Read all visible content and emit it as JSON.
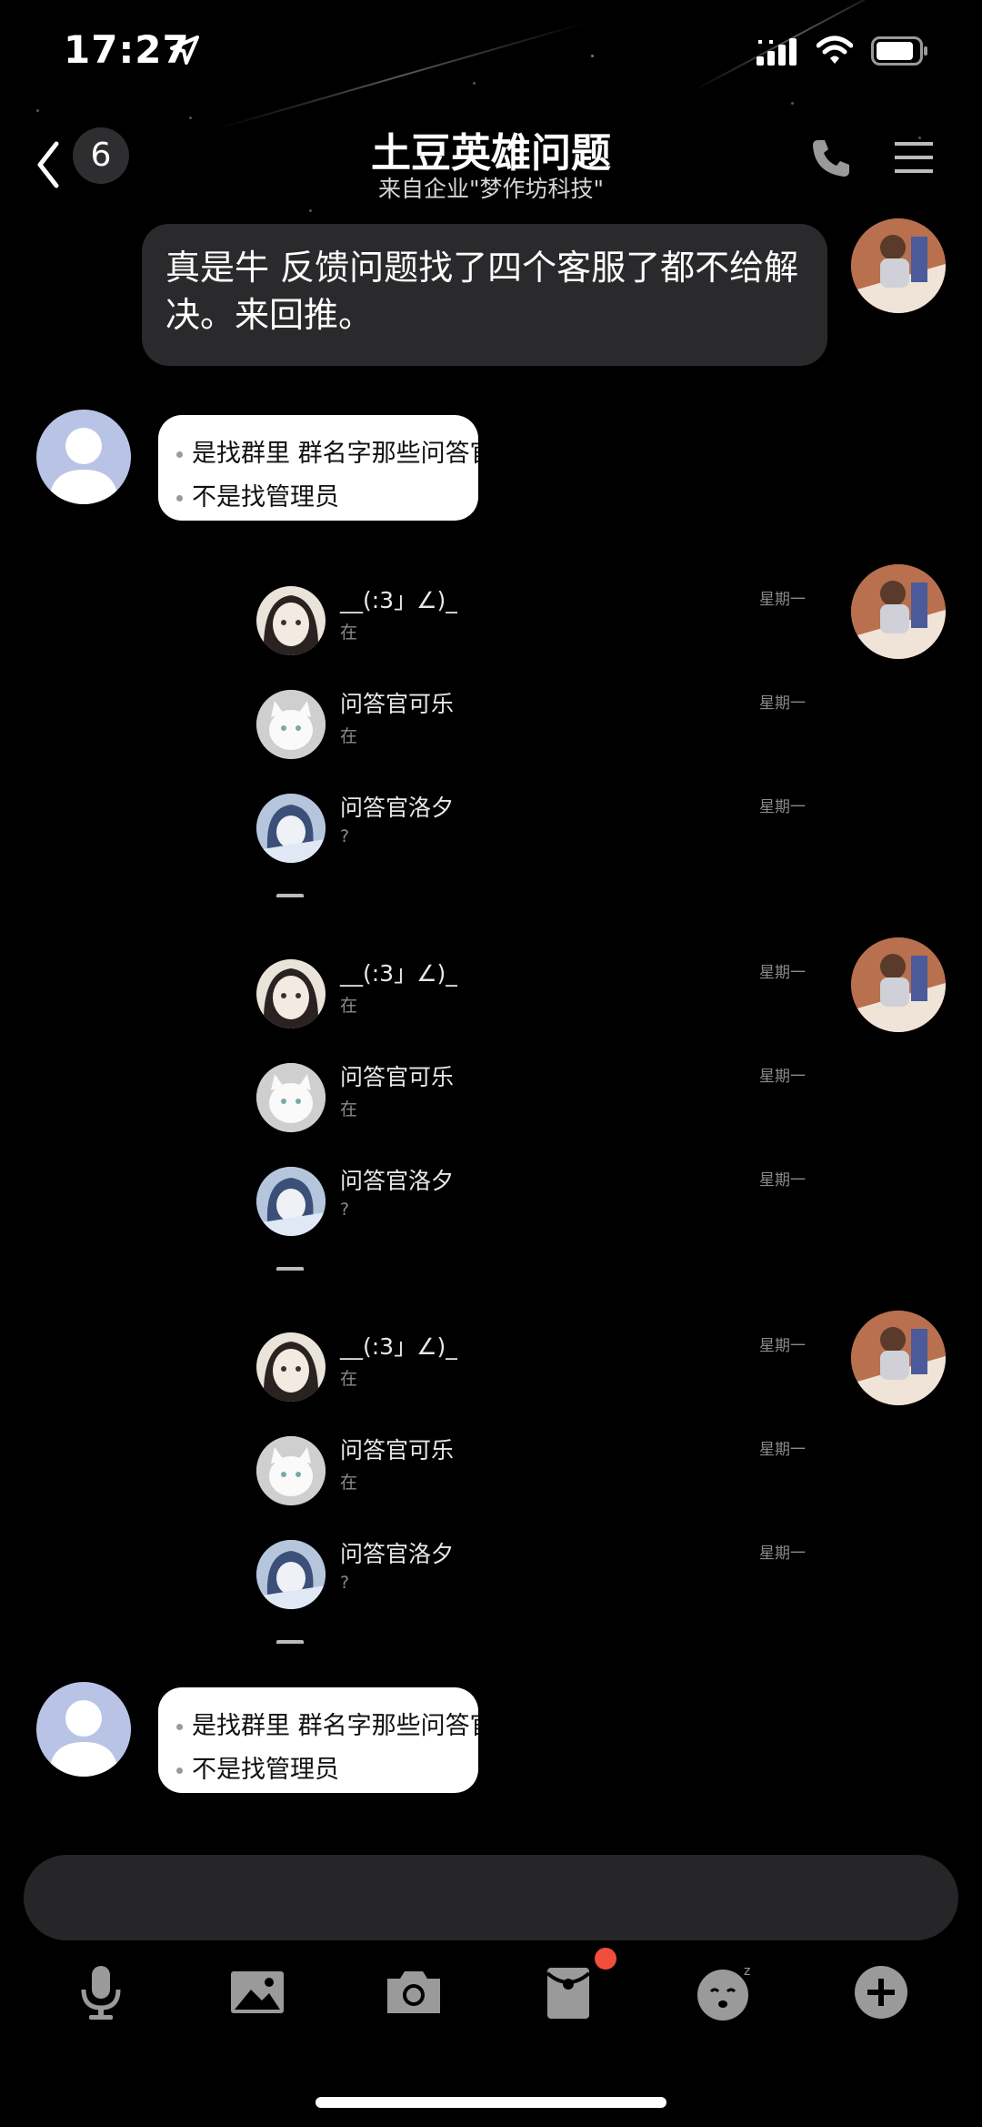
{
  "status_bar": {
    "time": "17:27"
  },
  "header": {
    "back_count": "6",
    "title": "土豆英雄问题",
    "subtitle": "来自企业\"梦作坊科技\""
  },
  "messages": {
    "m1_text": "真是牛  反馈问题找了四个客服了都不给解决。来回推。",
    "m2_line1": "是找群里 群名字那些问答官",
    "m2_line2": "不是找管理员",
    "m6_line1": "是找群里 群名字那些问答官",
    "m6_line2": "不是找管理员"
  },
  "forwarded_chat_list": [
    {
      "rows": [
        {
          "name": "__(:3」∠)_",
          "preview": "在",
          "date": "星期一"
        },
        {
          "name": "问答官可乐",
          "preview": "在",
          "date": "星期一"
        },
        {
          "name": "问答官洛夕",
          "preview": "?",
          "date": "星期一"
        }
      ]
    },
    {
      "rows": [
        {
          "name": "__(:3」∠)_",
          "preview": "在",
          "date": "星期一"
        },
        {
          "name": "问答官可乐",
          "preview": "在",
          "date": "星期一"
        },
        {
          "name": "问答官洛夕",
          "preview": "?",
          "date": "星期一"
        }
      ]
    },
    {
      "rows": [
        {
          "name": "__(:3」∠)_",
          "preview": "在",
          "date": "星期一"
        },
        {
          "name": "问答官可乐",
          "preview": "在",
          "date": "星期一"
        },
        {
          "name": "问答官洛夕",
          "preview": "?",
          "date": "星期一"
        }
      ]
    }
  ],
  "input": {
    "placeholder": ""
  },
  "toolbar": {
    "icons": [
      "microphone-icon",
      "image-icon",
      "camera-icon",
      "red-packet-icon",
      "emoji-icon",
      "plus-icon"
    ],
    "accent_color": "#f24e3d"
  },
  "colors": {
    "background": "#000000",
    "bubble_dark": "#2a2a2c",
    "bubble_light": "#ffffff"
  }
}
